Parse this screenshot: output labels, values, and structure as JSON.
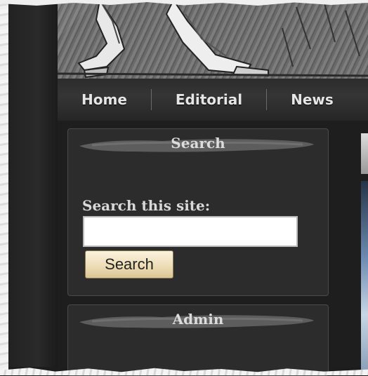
{
  "nav": {
    "items": [
      "Home",
      "Editorial",
      "News"
    ]
  },
  "search_block": {
    "title": "Search",
    "label": "Search this site:",
    "input_value": "",
    "button_label": "Search"
  },
  "admin_block": {
    "title": "Admin"
  },
  "colors": {
    "background": "#1d1d1d",
    "nav_text": "#e6e6e6",
    "button_fill": "#ecdcb4"
  }
}
